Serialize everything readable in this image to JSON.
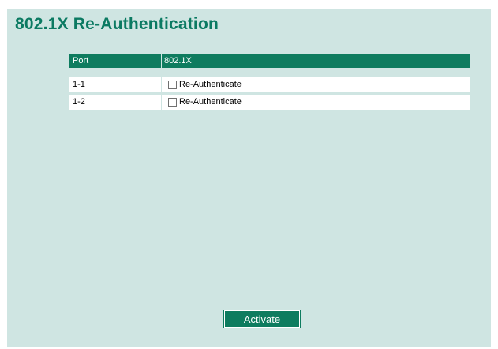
{
  "page": {
    "title": "802.1X Re-Authentication"
  },
  "table": {
    "headers": {
      "port": "Port",
      "auth": "802.1X"
    },
    "rows": [
      {
        "port": "1-1",
        "checkbox_label": "Re-Authenticate",
        "checked": false
      },
      {
        "port": "1-2",
        "checkbox_label": "Re-Authenticate",
        "checked": false
      }
    ]
  },
  "actions": {
    "activate_label": "Activate"
  },
  "colors": {
    "background": "#cfe5e2",
    "accent": "#0e7c5f",
    "title": "#0b7a62"
  }
}
